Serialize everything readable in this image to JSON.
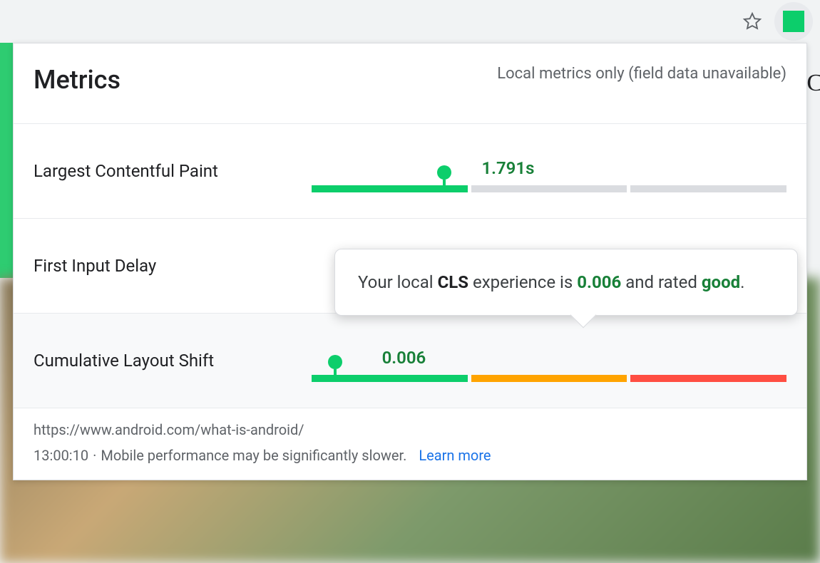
{
  "header": {
    "title": "Metrics",
    "subtitle": "Local metrics only (field data unavailable)"
  },
  "metrics": {
    "lcp": {
      "label": "Largest Contentful Paint",
      "value": "1.791s",
      "marker_percent": 28,
      "value_percent": 34,
      "segment_style": "lcp"
    },
    "fid": {
      "label": "First Input Delay"
    },
    "cls": {
      "label": "Cumulative Layout Shift",
      "value": "0.006",
      "marker_percent": 5,
      "value_percent": 13,
      "segment_style": "cls"
    }
  },
  "tooltip": {
    "prefix": "Your local ",
    "abbr": "CLS",
    "middle": " experience is ",
    "value": "0.006",
    "and": " and rated ",
    "rating": "good",
    "suffix": "."
  },
  "footer": {
    "url": "https://www.android.com/what-is-android/",
    "time": "13:00:10",
    "separator": " · ",
    "note": "Mobile performance may be significantly slower.",
    "link": "Learn more"
  },
  "colors": {
    "good": "#0cce6b",
    "warn": "#ffa400",
    "bad": "#ff4e42",
    "grey": "#dadce0"
  }
}
